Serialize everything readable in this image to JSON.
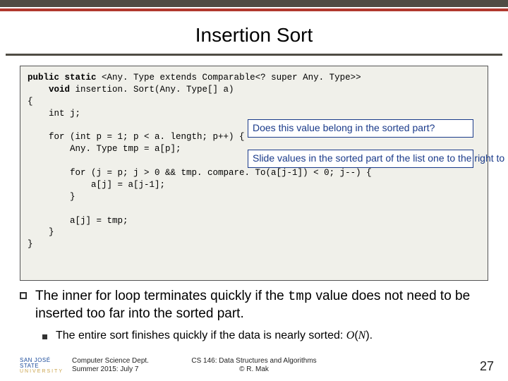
{
  "title": "Insertion Sort",
  "code": {
    "l1a": "public static ",
    "l1b": "<Any. Type extends Comparable<? super Any. Type>>",
    "l2a": "    void ",
    "l2b": "insertion. Sort(Any. Type[] a)",
    "l3": "{",
    "l4": "    int j;",
    "l5": "",
    "l6": "    for (int p = 1; p < a. length; p++) {",
    "l7": "        Any. Type tmp = a[p];",
    "l8": "",
    "l9": "        for (j = p; j > 0 && tmp. compare. To(a[j-1]) < 0; j--) {",
    "l10": "            a[j] = a[j-1];",
    "l11": "        }",
    "l12": "",
    "l13": "        a[j] = tmp;",
    "l14": "    }",
    "l15": "}"
  },
  "callout1": "Does this value belong in the sorted part?",
  "callout2": "Slide values in the sorted part of the list one to the right to make room for a new member of the sorted part.",
  "bullet_pre": "The inner for loop terminates quickly if the ",
  "bullet_mono": "tmp",
  "bullet_post": " value does not need to be inserted too far into the sorted part.",
  "sub_pre": "The entire sort finishes quickly if the data is nearly sorted: ",
  "sub_o": "O",
  "sub_paren_open": "(",
  "sub_n": "N",
  "sub_paren_close": ").",
  "footer": {
    "logo1": "SAN JOSÉ STATE",
    "logo2": "UNIVERSITY",
    "dept1": "Computer Science Dept.",
    "dept2": "Summer 2015: July 7",
    "course1": "CS 146: Data Structures and Algorithms",
    "course2": "© R. Mak",
    "page": "27"
  }
}
